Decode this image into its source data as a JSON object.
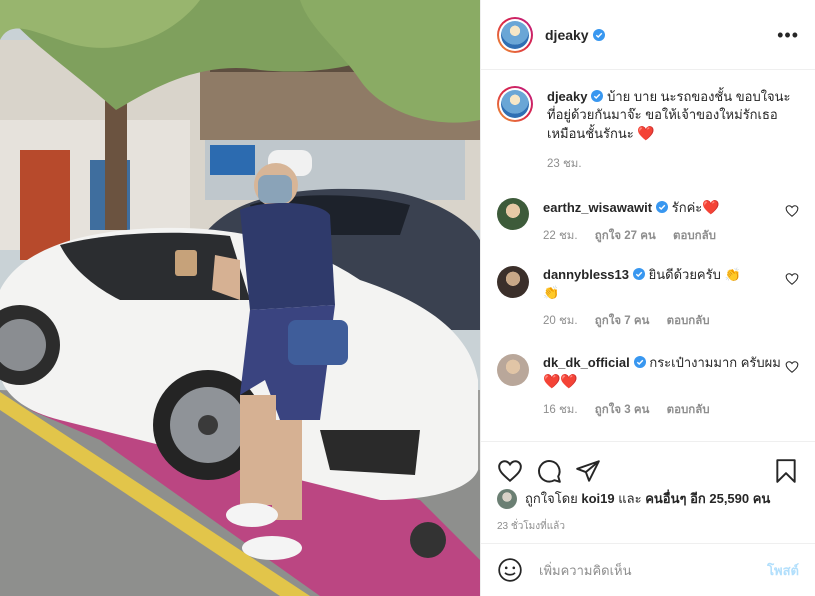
{
  "post": {
    "username": "djeaky",
    "more_label": "•••",
    "caption": {
      "text": "บ้าย บาย นะรถของชั้น ขอบใจนะที่อยู่ด้วยกันมาจ๊ะ ขอให้เจ้าของใหม่รักเธอเหมือนชั้นรักนะ",
      "emoji": "❤️",
      "time": "23 ชม."
    },
    "comments": [
      {
        "username": "earthz_wisawawit",
        "text": "รักค่ะ",
        "emoji": "❤️",
        "time": "22 ชม.",
        "likes": "ถูกใจ 27 คน",
        "reply": "ตอบกลับ"
      },
      {
        "username": "dannybless13",
        "text": "ยินดีด้วยครับ",
        "emoji": "👏",
        "emoji2": "👏",
        "time": "20 ชม.",
        "likes": "ถูกใจ 7 คน",
        "reply": "ตอบกลับ"
      },
      {
        "username": "dk_dk_official",
        "text": "กระเป๋างามมาก ครับผม",
        "emoji": "❤️❤️",
        "time": "16 ชม.",
        "likes": "ถูกใจ 3 คน",
        "reply": "ตอบกลับ"
      }
    ],
    "liked_by": {
      "prefix": "ถูกใจโดย",
      "user": "koi19",
      "and": "และ",
      "others": "คนอื่นๆ อีก 25,590 คน"
    },
    "posted_ago": "23 ชั่วโมงที่แล้ว",
    "add_comment_placeholder": "เพิ่มความคิดเห็น",
    "post_button": "โพสต์"
  },
  "colors": {
    "verified": "#3897f0",
    "heart": "#ed4956",
    "post_disabled": "#b2dffc",
    "muted": "#8e8e8e"
  },
  "icons": [
    "verified-badge-icon",
    "more-options-icon",
    "heart-icon",
    "comment-icon",
    "share-icon",
    "bookmark-icon",
    "emoji-icon"
  ]
}
